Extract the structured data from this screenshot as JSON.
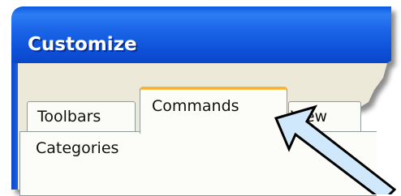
{
  "window": {
    "title": "Customize"
  },
  "tabs": [
    {
      "label": "Toolbars",
      "selected": false
    },
    {
      "label": "Commands",
      "selected": true
    },
    {
      "label": "View",
      "selected": false
    }
  ],
  "panel": {
    "categories_label": "Categories"
  },
  "annotation": {
    "arrow_color": "#cfe8fb",
    "arrow_outline": "#000000"
  },
  "colors": {
    "titlebar_blue": "#0c4fd6",
    "dialog_bg": "#ece9d8",
    "selected_tab_accent": "#f7b42c"
  }
}
